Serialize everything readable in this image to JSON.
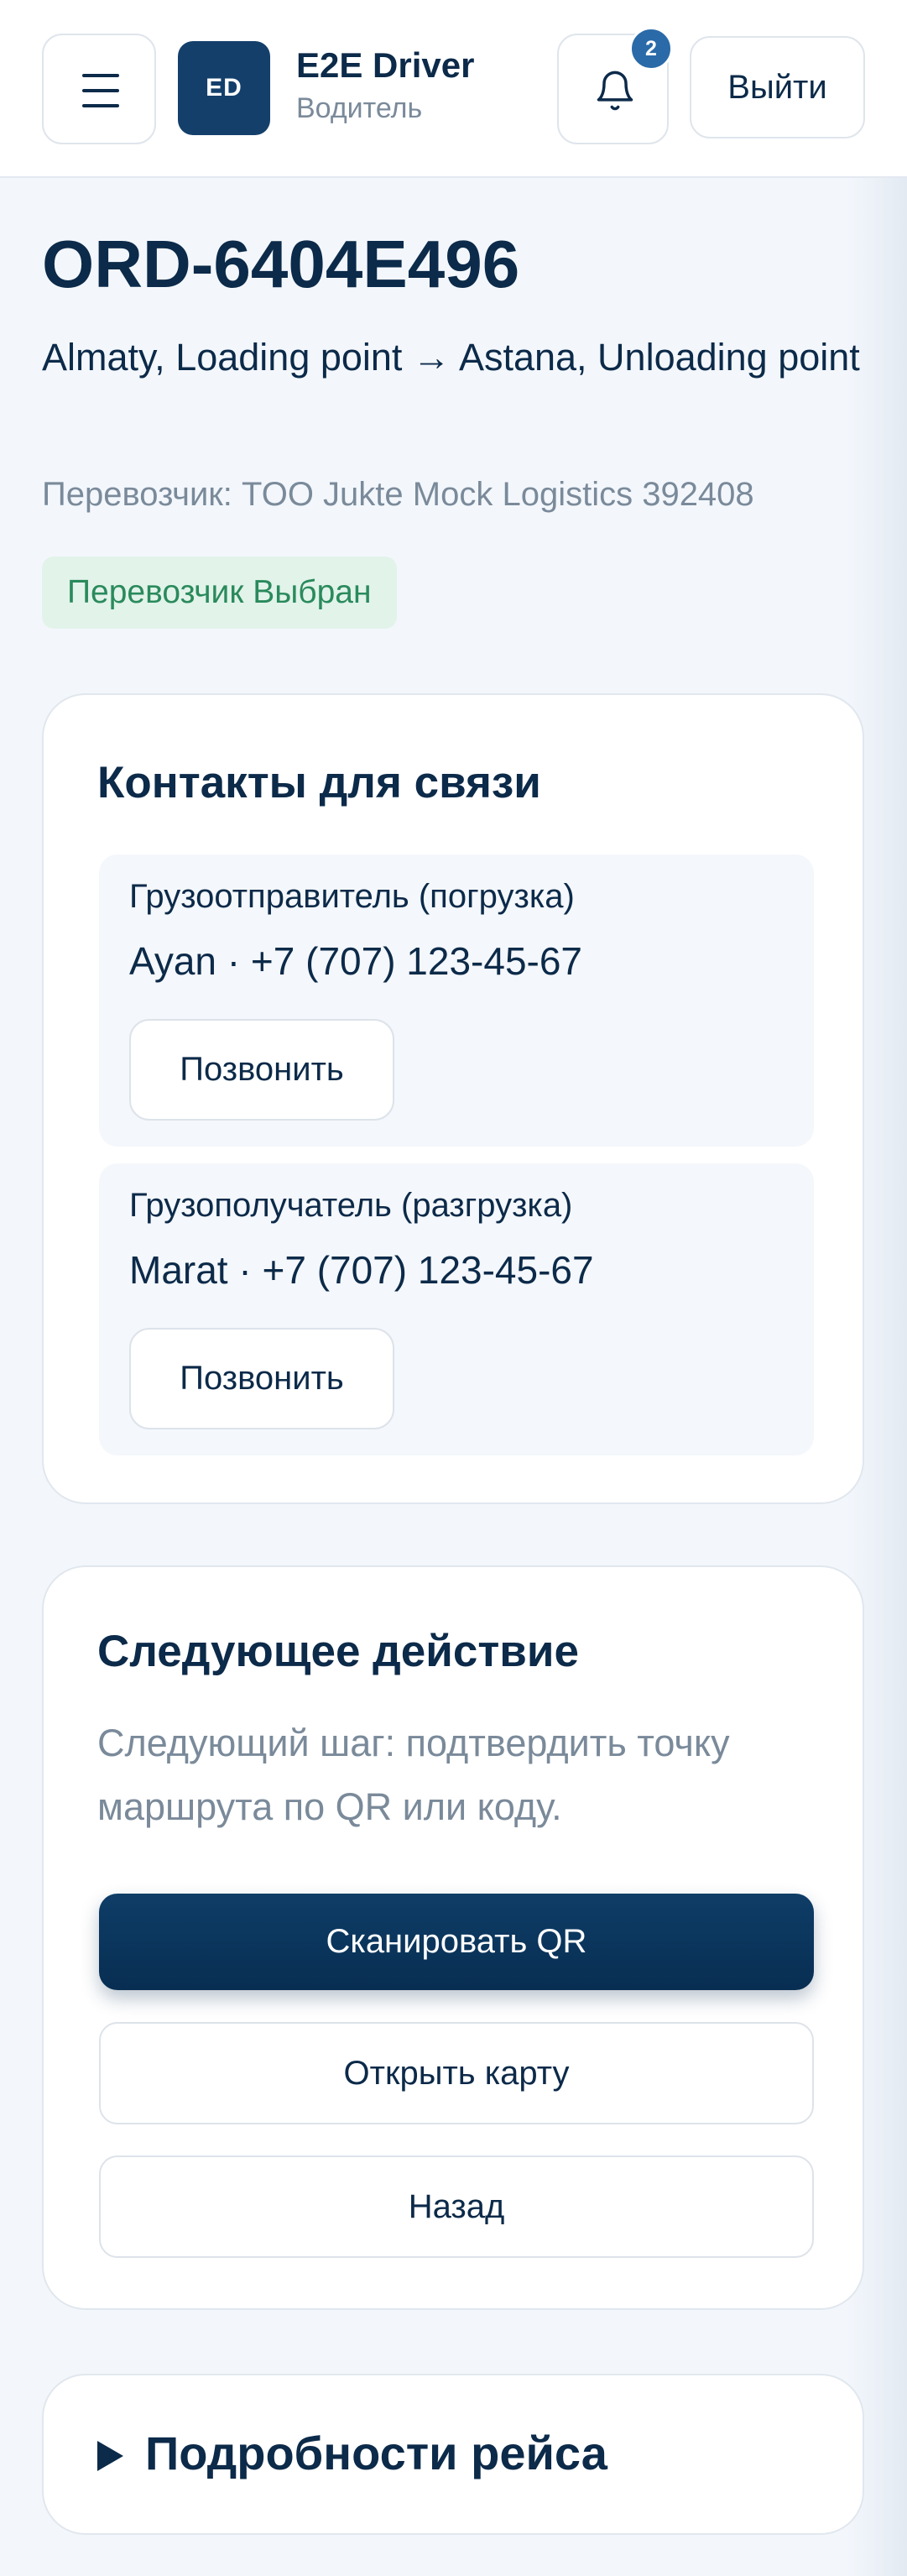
{
  "header": {
    "menu_icon": "hamburger-menu-icon",
    "avatar_initials": "ED",
    "app_name": "E2E Driver",
    "role": "Водитель",
    "bell_icon": "bell-icon",
    "notification_count": "2",
    "logout_label": "Выйти"
  },
  "order": {
    "id": "ORD-6404E496",
    "route": "Almaty, Loading point → Astana, Unloading point",
    "carrier": "Перевозчик: TOO Jukte Mock Logistics 392408",
    "status": "Перевозчик Выбран"
  },
  "contacts": {
    "title": "Контакты для связи",
    "items": [
      {
        "label": "Грузоотправитель (погрузка)",
        "value": "Ayan · +7 (707) 123-45-67",
        "call_label": "Позвонить"
      },
      {
        "label": "Грузополучатель (разгрузка)",
        "value": "Marat · +7 (707) 123-45-67",
        "call_label": "Позвонить"
      }
    ]
  },
  "next_action": {
    "title": "Следующее действие",
    "description": "Следующий шаг: подтвердить точку маршрута по QR или коду.",
    "scan_label": "Сканировать QR",
    "map_label": "Открыть карту",
    "back_label": "Назад"
  },
  "details": {
    "title": "Подробности рейса"
  },
  "colors": {
    "primary": "#0c2a49",
    "accent_blue": "#2a6aa8",
    "muted": "#7a8a9a",
    "status_bg": "#e2f3ea",
    "status_text": "#2a8a5c",
    "page_bg": "#f3f7fc"
  }
}
